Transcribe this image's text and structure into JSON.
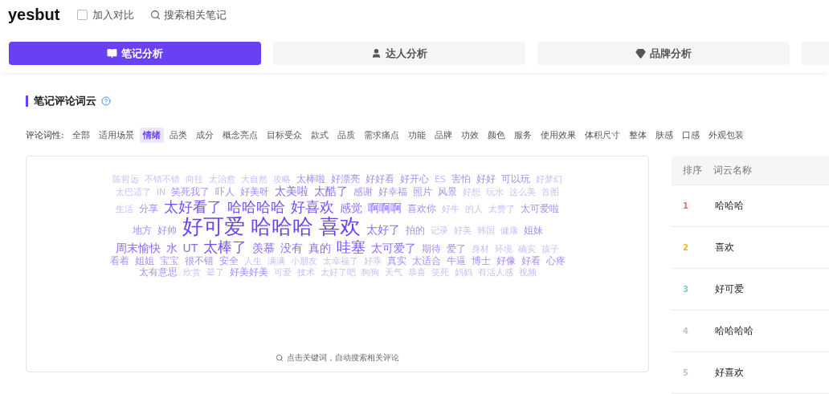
{
  "header": {
    "logo": "yesbut",
    "compare": {
      "label": "加入对比",
      "checked": false
    },
    "search": "搜索相关笔记"
  },
  "tabs": [
    {
      "label": "笔记分析",
      "selected": true
    },
    {
      "label": "达人分析",
      "selected": false
    },
    {
      "label": "品牌分析",
      "selected": false
    }
  ],
  "section": {
    "title": "笔记评论词云"
  },
  "filters": {
    "label": "评论词性:",
    "items": [
      {
        "label": "全部",
        "selected": false
      },
      {
        "label": "适用场景",
        "selected": false
      },
      {
        "label": "情绪",
        "selected": true
      },
      {
        "label": "品类",
        "selected": false
      },
      {
        "label": "成分",
        "selected": false
      },
      {
        "label": "概念亮点",
        "selected": false
      },
      {
        "label": "目标受众",
        "selected": false
      },
      {
        "label": "款式",
        "selected": false
      },
      {
        "label": "品质",
        "selected": false
      },
      {
        "label": "需求痛点",
        "selected": false
      },
      {
        "label": "功能",
        "selected": false
      },
      {
        "label": "品牌",
        "selected": false
      },
      {
        "label": "功效",
        "selected": false
      },
      {
        "label": "颜色",
        "selected": false
      },
      {
        "label": "服务",
        "selected": false
      },
      {
        "label": "使用效果",
        "selected": false
      },
      {
        "label": "体积尺寸",
        "selected": false
      },
      {
        "label": "整体",
        "selected": false
      },
      {
        "label": "肤感",
        "selected": false
      },
      {
        "label": "口感",
        "selected": false
      },
      {
        "label": "外观包装",
        "selected": false
      }
    ]
  },
  "word_cloud": {
    "words": [
      {
        "text": "陈哲远",
        "kind": "xs"
      },
      {
        "text": "不错不错",
        "kind": "xs"
      },
      {
        "text": "向往",
        "kind": "xs"
      },
      {
        "text": "太治愈",
        "kind": "xs"
      },
      {
        "text": "大自然",
        "kind": "xs"
      },
      {
        "text": "攻略",
        "kind": "xs"
      },
      {
        "text": "太棒啦",
        "kind": "s"
      },
      {
        "text": "好漂亮",
        "kind": "s"
      },
      {
        "text": "好好看",
        "kind": "s"
      },
      {
        "text": "好开心",
        "kind": "s"
      },
      {
        "text": "ES",
        "kind": "xs"
      },
      {
        "text": "害怕",
        "kind": "s"
      },
      {
        "text": "好好",
        "kind": "s"
      },
      {
        "text": "可以玩",
        "kind": "s"
      },
      {
        "text": "好梦幻",
        "kind": "xs"
      },
      {
        "text": "太巴适了",
        "kind": "xs"
      },
      {
        "text": "IN",
        "kind": "xs"
      },
      {
        "text": "笑死我了",
        "kind": "s"
      },
      {
        "text": "吓人",
        "kind": "s"
      },
      {
        "text": "好美呀",
        "kind": "s"
      },
      {
        "text": "太美啦",
        "kind": "m"
      },
      {
        "text": "太酷了",
        "kind": "m"
      },
      {
        "text": "感谢",
        "kind": "s"
      },
      {
        "text": "好幸福",
        "kind": "s"
      },
      {
        "text": "照片",
        "kind": "s"
      },
      {
        "text": "风景",
        "kind": "s"
      },
      {
        "text": "好想",
        "kind": "xs"
      },
      {
        "text": "玩水",
        "kind": "xs"
      },
      {
        "text": "这么美",
        "kind": "xs"
      },
      {
        "text": "首图",
        "kind": "xs"
      },
      {
        "text": "生活",
        "kind": "xs"
      },
      {
        "text": "分享",
        "kind": "s"
      },
      {
        "text": "太好看了",
        "kind": "l"
      },
      {
        "text": "哈哈哈哈",
        "kind": "l"
      },
      {
        "text": "好喜欢",
        "kind": "l"
      },
      {
        "text": "感觉",
        "kind": "m"
      },
      {
        "text": "啊啊啊",
        "kind": "m"
      },
      {
        "text": "喜欢你",
        "kind": "s"
      },
      {
        "text": "好牛",
        "kind": "xs"
      },
      {
        "text": "的人",
        "kind": "xs"
      },
      {
        "text": "太赞了",
        "kind": "xs"
      },
      {
        "text": "太可爱啦",
        "kind": "s"
      },
      {
        "text": "地方",
        "kind": "s"
      },
      {
        "text": "好帅",
        "kind": "s"
      },
      {
        "text": "好可爱",
        "kind": "xl"
      },
      {
        "text": "哈哈哈",
        "kind": "xl"
      },
      {
        "text": "喜欢",
        "kind": "xl"
      },
      {
        "text": "太好了",
        "kind": "m"
      },
      {
        "text": "拍的",
        "kind": "s"
      },
      {
        "text": "记录",
        "kind": "xs"
      },
      {
        "text": "好美",
        "kind": "xs"
      },
      {
        "text": "韩国",
        "kind": "xs"
      },
      {
        "text": "健康",
        "kind": "xs"
      },
      {
        "text": "姐妹",
        "kind": "s"
      },
      {
        "text": "周末愉快",
        "kind": "m"
      },
      {
        "text": "水",
        "kind": "m"
      },
      {
        "text": "UT",
        "kind": "m"
      },
      {
        "text": "太棒了",
        "kind": "l"
      },
      {
        "text": "羡慕",
        "kind": "m"
      },
      {
        "text": "没有",
        "kind": "m"
      },
      {
        "text": "真的",
        "kind": "m"
      },
      {
        "text": "哇塞",
        "kind": "l"
      },
      {
        "text": "太可爱了",
        "kind": "m"
      },
      {
        "text": "期待",
        "kind": "s"
      },
      {
        "text": "爱了",
        "kind": "s"
      },
      {
        "text": "身材",
        "kind": "xs"
      },
      {
        "text": "环境",
        "kind": "xs"
      },
      {
        "text": "确实",
        "kind": "xs"
      },
      {
        "text": "孩子",
        "kind": "xs"
      },
      {
        "text": "看着",
        "kind": "s"
      },
      {
        "text": "姐姐",
        "kind": "s"
      },
      {
        "text": "宝宝",
        "kind": "s"
      },
      {
        "text": "很不错",
        "kind": "s"
      },
      {
        "text": "安全",
        "kind": "s"
      },
      {
        "text": "人生",
        "kind": "xs"
      },
      {
        "text": "满满",
        "kind": "xs"
      },
      {
        "text": "小朋友",
        "kind": "xs"
      },
      {
        "text": "太幸福了",
        "kind": "xs"
      },
      {
        "text": "好乖",
        "kind": "xs"
      },
      {
        "text": "真实",
        "kind": "s"
      },
      {
        "text": "太适合",
        "kind": "s"
      },
      {
        "text": "牛逼",
        "kind": "s"
      },
      {
        "text": "博士",
        "kind": "s"
      },
      {
        "text": "好像",
        "kind": "s"
      },
      {
        "text": "好看",
        "kind": "s"
      },
      {
        "text": "心疼",
        "kind": "s"
      },
      {
        "text": "太有意思",
        "kind": "s"
      },
      {
        "text": "欣赏",
        "kind": "xs"
      },
      {
        "text": "晕了",
        "kind": "xs"
      },
      {
        "text": "好美好美",
        "kind": "s"
      },
      {
        "text": "可爱",
        "kind": "xs"
      },
      {
        "text": "技术",
        "kind": "xs"
      },
      {
        "text": "太好了吧",
        "kind": "xs"
      },
      {
        "text": "狗狗",
        "kind": "xs"
      },
      {
        "text": "天气",
        "kind": "xs"
      },
      {
        "text": "恭喜",
        "kind": "xs"
      },
      {
        "text": "笑死",
        "kind": "xs"
      },
      {
        "text": "妈妈",
        "kind": "xs"
      },
      {
        "text": "有活人感",
        "kind": "xs"
      },
      {
        "text": "视频",
        "kind": "xs"
      }
    ],
    "hint": "点击关键词，自动搜索相关评论"
  },
  "ranking": {
    "columns": [
      "排序",
      "词云名称"
    ],
    "rows": [
      {
        "rank": "1",
        "name": "哈哈哈",
        "color": "#f26b6b"
      },
      {
        "rank": "2",
        "name": "喜欢",
        "color": "#f2b21b"
      },
      {
        "rank": "3",
        "name": "好可爱",
        "color": "#6fd3d3"
      },
      {
        "rank": "4",
        "name": "哈哈哈哈",
        "color": "#c4c4c4"
      },
      {
        "rank": "5",
        "name": "好喜欢",
        "color": "#c4c4c4"
      }
    ]
  }
}
